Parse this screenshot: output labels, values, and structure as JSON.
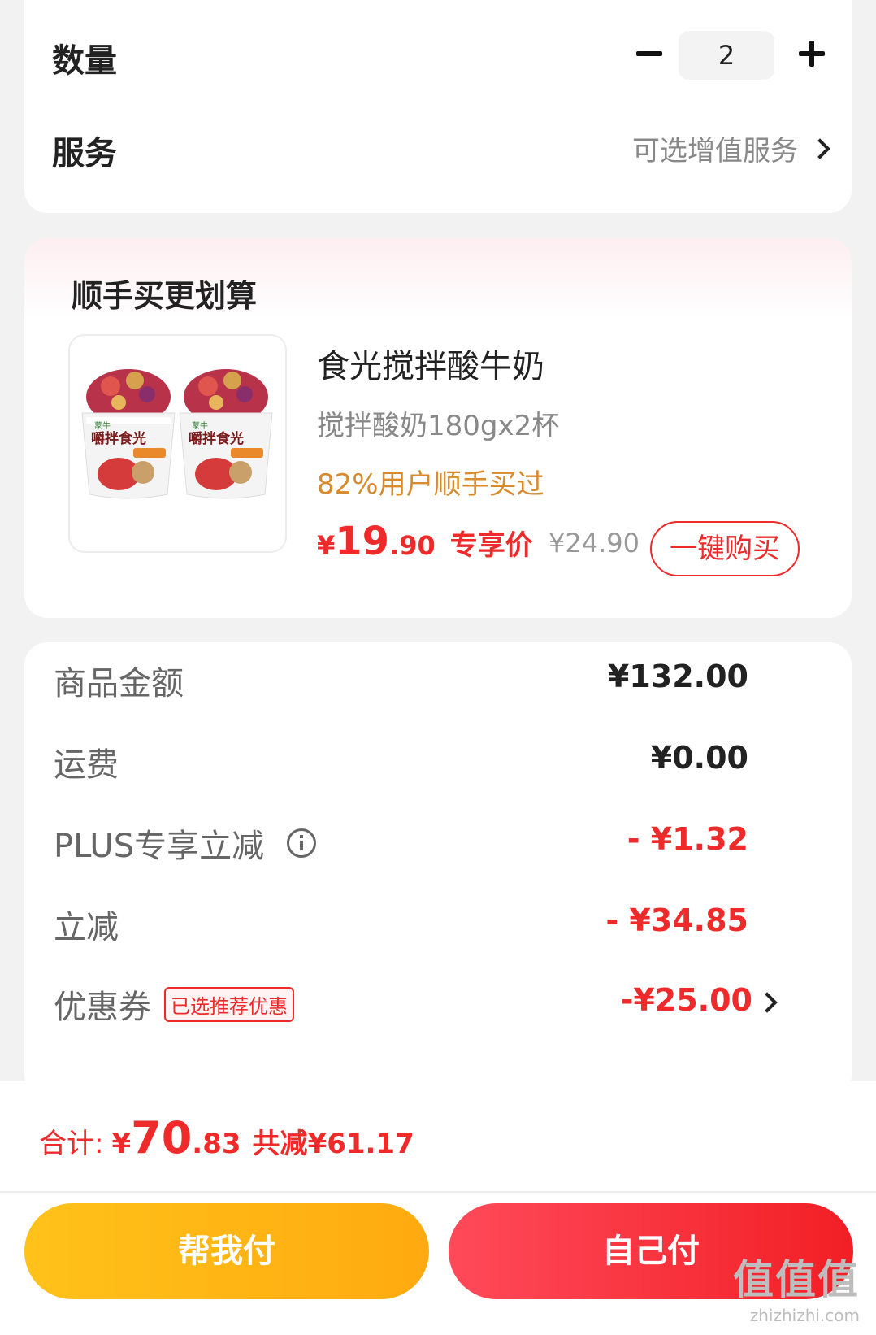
{
  "options": {
    "quantity_label": "数量",
    "quantity_value": "2",
    "service_label": "服务",
    "service_link": "可选增值服务"
  },
  "recommend": {
    "title": "顺手买更划算",
    "product": {
      "name": "食光搅拌酸牛奶",
      "spec": "搅拌酸奶180gx2杯",
      "stat": "82%用户顺手买过",
      "price_symbol": "¥",
      "price_int": "19",
      "price_dec": ".90",
      "price_tag": "专享价",
      "original_price": "¥24.90",
      "buy_label": "一键购买",
      "image_text": "嚼拌食光",
      "image_brand": "蒙牛"
    }
  },
  "details": {
    "rows": [
      {
        "label": "商品金额",
        "value": "¥132.00"
      },
      {
        "label": "运费",
        "value": "¥0.00"
      },
      {
        "label": "PLUS专享立减",
        "value": "- ¥1.32"
      },
      {
        "label": "立减",
        "value": "- ¥34.85"
      },
      {
        "label": "优惠券",
        "badge": "已选推荐优惠",
        "value": "-¥25.00"
      }
    ]
  },
  "footer": {
    "total_label": "合计:",
    "total_symbol": "¥",
    "total_int": "70",
    "total_dec": ".83",
    "saved": "共减¥61.17",
    "help_pay": "帮我付",
    "self_pay": "自己付"
  },
  "watermark": {
    "big": "值值值",
    "small": "zhizhizhi.com"
  },
  "colors": {
    "accent_red": "#ee2a2a",
    "stat_orange": "#d98a2a",
    "help_btn": "#ffb414",
    "self_btn": "#f5303a"
  }
}
